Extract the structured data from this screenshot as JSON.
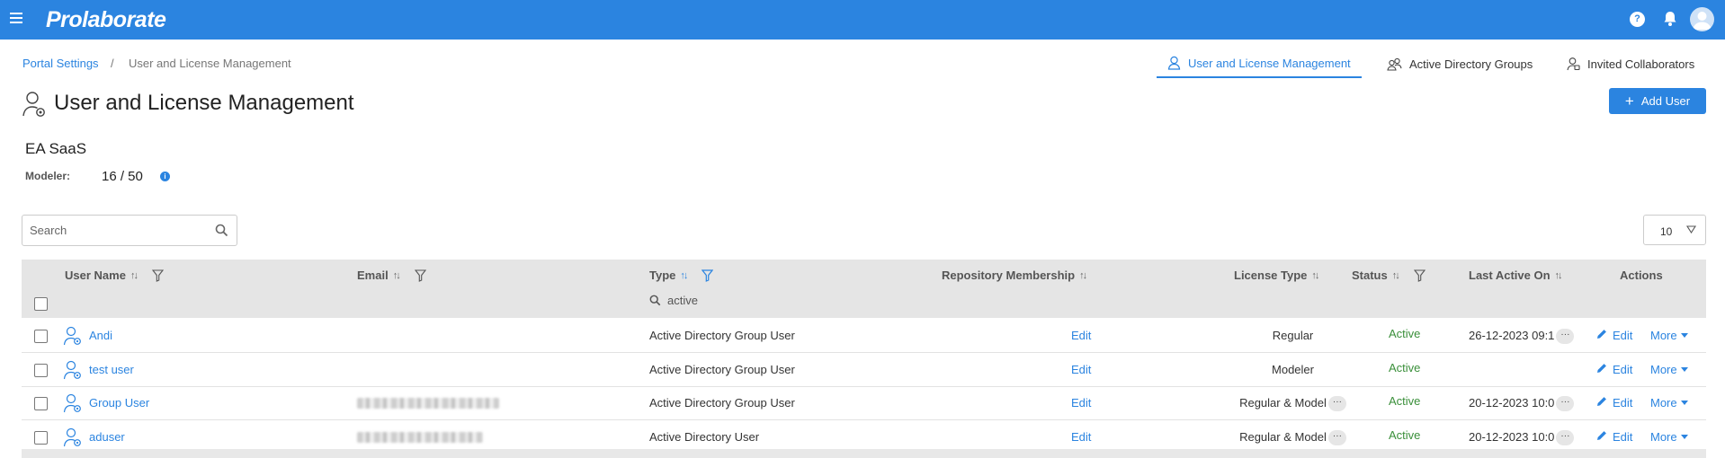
{
  "app": {
    "brand": "Prolaborate"
  },
  "topbar": {
    "help_icon": "question-circle-icon",
    "help_glyph": "?",
    "bell_icon": "bell-icon",
    "avatar_icon": "user-avatar-icon"
  },
  "breadcrumb": {
    "parent": "Portal Settings",
    "separator": "/",
    "current": "User and License Management"
  },
  "tabs": [
    {
      "label": "User and License Management",
      "icon": "user-icon",
      "active": true
    },
    {
      "label": "Active Directory Groups",
      "icon": "group-icon",
      "active": false
    },
    {
      "label": "Invited Collaborators",
      "icon": "invited-user-icon",
      "active": false
    }
  ],
  "page": {
    "title": "User and License Management",
    "add_user_label": "Add User",
    "add_user_glyph": "+"
  },
  "license": {
    "org": "EA SaaS",
    "label": "Modeler:",
    "value": "16 / 50",
    "info_glyph": "i"
  },
  "search": {
    "placeholder": "Search",
    "value": ""
  },
  "page_size": {
    "value": "10"
  },
  "table": {
    "columns": {
      "user_name": "User Name",
      "email": "Email",
      "type": "Type",
      "repo": "Repository Membership",
      "license_type": "License Type",
      "status": "Status",
      "last_active": "Last Active On",
      "actions": "Actions"
    },
    "sort_glyph": "↑↓",
    "type_filter_value": "active",
    "rows": [
      {
        "name": "Andi",
        "email_blurred": false,
        "type": "Active Directory Group User",
        "repo": "Edit",
        "license": "Regular",
        "license_more": false,
        "status": "Active",
        "last_active": "26-12-2023 09:1",
        "last_more": true,
        "edit": "Edit",
        "more": "More"
      },
      {
        "name": "test user",
        "email_blurred": false,
        "type": "Active Directory Group User",
        "repo": "Edit",
        "license": "Modeler",
        "license_more": false,
        "status": "Active",
        "last_active": "",
        "last_more": false,
        "edit": "Edit",
        "more": "More"
      },
      {
        "name": "Group User",
        "email_blurred": true,
        "type": "Active Directory Group User",
        "repo": "Edit",
        "license": "Regular & Model",
        "license_more": true,
        "status": "Active",
        "last_active": "20-12-2023 10:0",
        "last_more": true,
        "edit": "Edit",
        "more": "More"
      },
      {
        "name": "aduser",
        "email_blurred": true,
        "type": "Active Directory User",
        "repo": "Edit",
        "license": "Regular & Model",
        "license_more": true,
        "status": "Active",
        "last_active": "20-12-2023 10:0",
        "last_more": true,
        "edit": "Edit",
        "more": "More"
      }
    ]
  },
  "colors": {
    "brand": "#2b84e0",
    "status_active": "#3a8f3a",
    "header_bg": "#e5e5e5"
  }
}
